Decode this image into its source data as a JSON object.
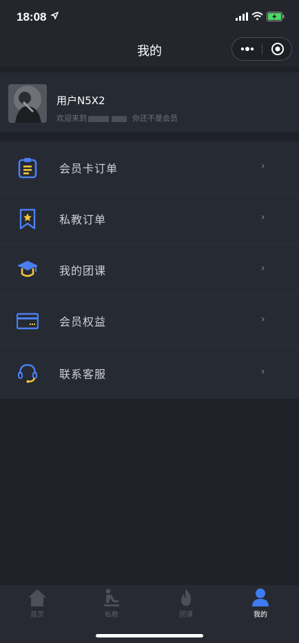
{
  "status_bar": {
    "time": "18:08"
  },
  "nav": {
    "title": "我的"
  },
  "profile": {
    "username": "用户N5X2",
    "welcome_prefix": "欢迎来到",
    "member_note": "你还不是会员"
  },
  "menu": {
    "items": [
      {
        "label": "会员卡订单",
        "icon": "clipboard-icon"
      },
      {
        "label": "私教订单",
        "icon": "bookmark-star-icon"
      },
      {
        "label": "我的团课",
        "icon": "graduation-cap-icon"
      },
      {
        "label": "会员权益",
        "icon": "card-icon"
      },
      {
        "label": "联系客服",
        "icon": "headset-icon"
      }
    ],
    "chevron": "›"
  },
  "tabs": [
    {
      "label": "首页",
      "icon": "home-icon",
      "active": false
    },
    {
      "label": "私教",
      "icon": "trainer-icon",
      "active": false
    },
    {
      "label": "团课",
      "icon": "flame-icon",
      "active": false
    },
    {
      "label": "我的",
      "icon": "user-icon",
      "active": true
    }
  ],
  "colors": {
    "background": "#1f2128",
    "panel": "#262a33",
    "icon_blue": "#4a7ff0",
    "icon_yellow": "#f3c63d",
    "tab_active": "#3d7cf2",
    "tab_inactive": "#4c4f57"
  }
}
